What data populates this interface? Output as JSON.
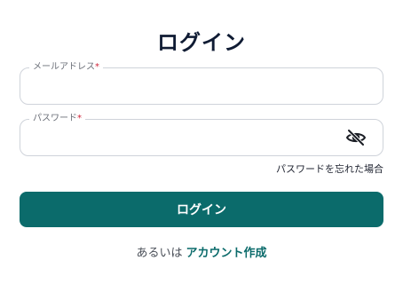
{
  "page": {
    "title": "ログイン"
  },
  "form": {
    "email": {
      "label": "メールアドレス",
      "required_mark": "*",
      "value": ""
    },
    "password": {
      "label": "パスワード",
      "required_mark": "*",
      "value": "",
      "visibility_icon": "eye-off-icon"
    },
    "forgot_password_link": "パスワードを忘れた場合",
    "submit_label": "ログイン"
  },
  "footer": {
    "prefix": "あるいは",
    "create_account_link": "アカウント作成"
  },
  "colors": {
    "primary": "#0b6b6b",
    "required": "#d0253a",
    "title": "#0f1b33",
    "border": "#cfd3da"
  }
}
